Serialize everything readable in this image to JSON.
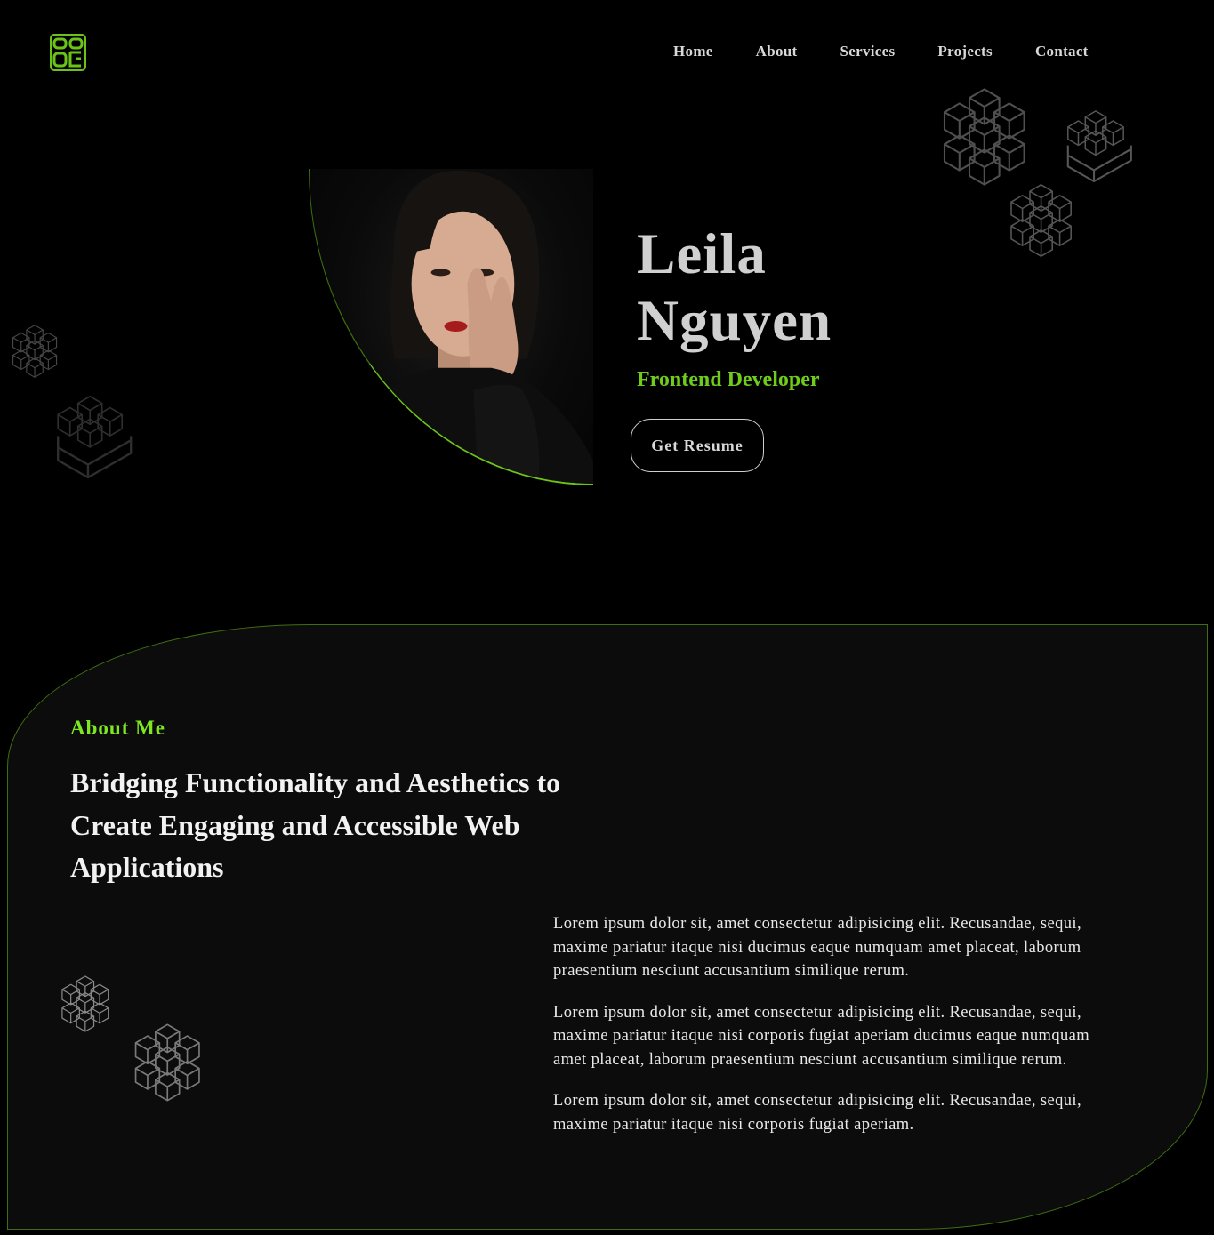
{
  "logo": {
    "name": "logo-icon",
    "accent": "#6cc318"
  },
  "nav": {
    "items": [
      "Home",
      "About",
      "Services",
      "Projects",
      "Contact"
    ]
  },
  "hero": {
    "first_name": "Leila",
    "last_name": "Nguyen",
    "role": "Frontend Developer",
    "button_label": "Get Resume"
  },
  "about": {
    "label": "About Me",
    "heading": "Bridging Functionality and Aesthetics to Create Engaging and Accessible Web Applications",
    "paragraphs": [
      "Lorem ipsum dolor sit, amet consectetur adipisicing elit. Recusandae, sequi, maxime pariatur itaque nisi ducimus eaque numquam amet placeat, laborum praesentium nesciunt accusantium similique rerum.",
      "Lorem ipsum dolor sit, amet consectetur adipisicing elit. Recusandae, sequi, maxime pariatur itaque nisi corporis fugiat aperiam ducimus eaque numquam amet placeat, laborum praesentium nesciunt accusantium similique rerum.",
      "Lorem ipsum dolor sit, amet consectetur adipisicing elit. Recusandae, sequi, maxime pariatur itaque nisi corporis fugiat aperiam."
    ]
  },
  "colors": {
    "background": "#000000",
    "section_background": "#0c0c0c",
    "accent_green": "#6cc318",
    "heading_text": "#d0d0d0",
    "cube_stroke": "#4a4a4a"
  }
}
